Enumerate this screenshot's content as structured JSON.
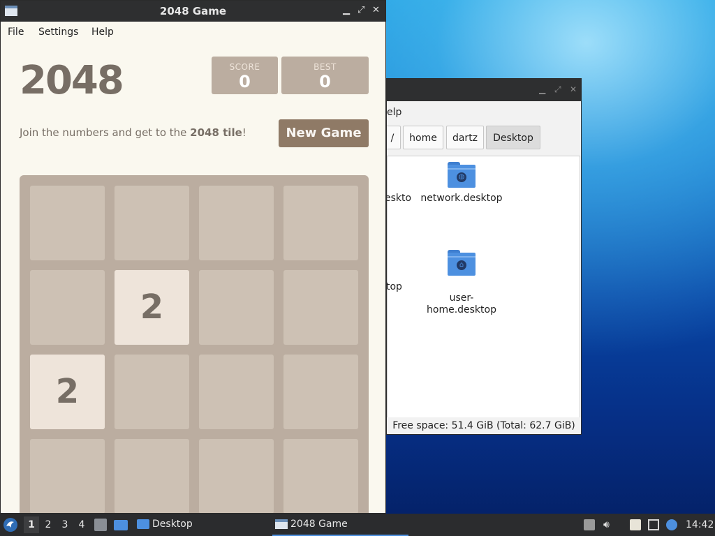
{
  "file_manager": {
    "menu_fragment": "elp",
    "path_segments": [
      "/",
      "home",
      "dartz",
      "Desktop"
    ],
    "items": [
      {
        "label_partial": "eskto"
      },
      {
        "label": "network.desktop",
        "icon": "globe-folder-icon"
      },
      {
        "label_partial": "top"
      },
      {
        "label": "user-\nhome.desktop",
        "icon": "home-folder-icon"
      }
    ],
    "status": "Free space: 51.4 GiB (Total: 62.7 GiB)"
  },
  "game_window": {
    "title": "2048 Game",
    "menu": [
      "File",
      "Settings",
      "Help"
    ],
    "heading": "2048",
    "score_label": "SCORE",
    "score_value": "0",
    "best_label": "BEST",
    "best_value": "0",
    "intro_prefix": "Join the numbers and get to the ",
    "intro_bold": "2048 tile",
    "intro_suffix": "!",
    "new_game_label": "New Game",
    "tiles": [
      {
        "row": 1,
        "col": 1,
        "value": "2"
      },
      {
        "row": 2,
        "col": 0,
        "value": "2"
      }
    ],
    "colors": {
      "background": "#faf8ef",
      "board": "#bbada0",
      "empty_cell": "#cdc1b4",
      "tile_2": "#eee4da",
      "button": "#8f7a66",
      "text": "#776e65"
    }
  },
  "taskbar": {
    "workspaces": [
      "1",
      "2",
      "3",
      "4"
    ],
    "tasks": [
      {
        "label": "Desktop",
        "icon": "folder-icon"
      },
      {
        "label": "2048 Game",
        "icon": "window-icon"
      }
    ],
    "clock": "14:42"
  }
}
